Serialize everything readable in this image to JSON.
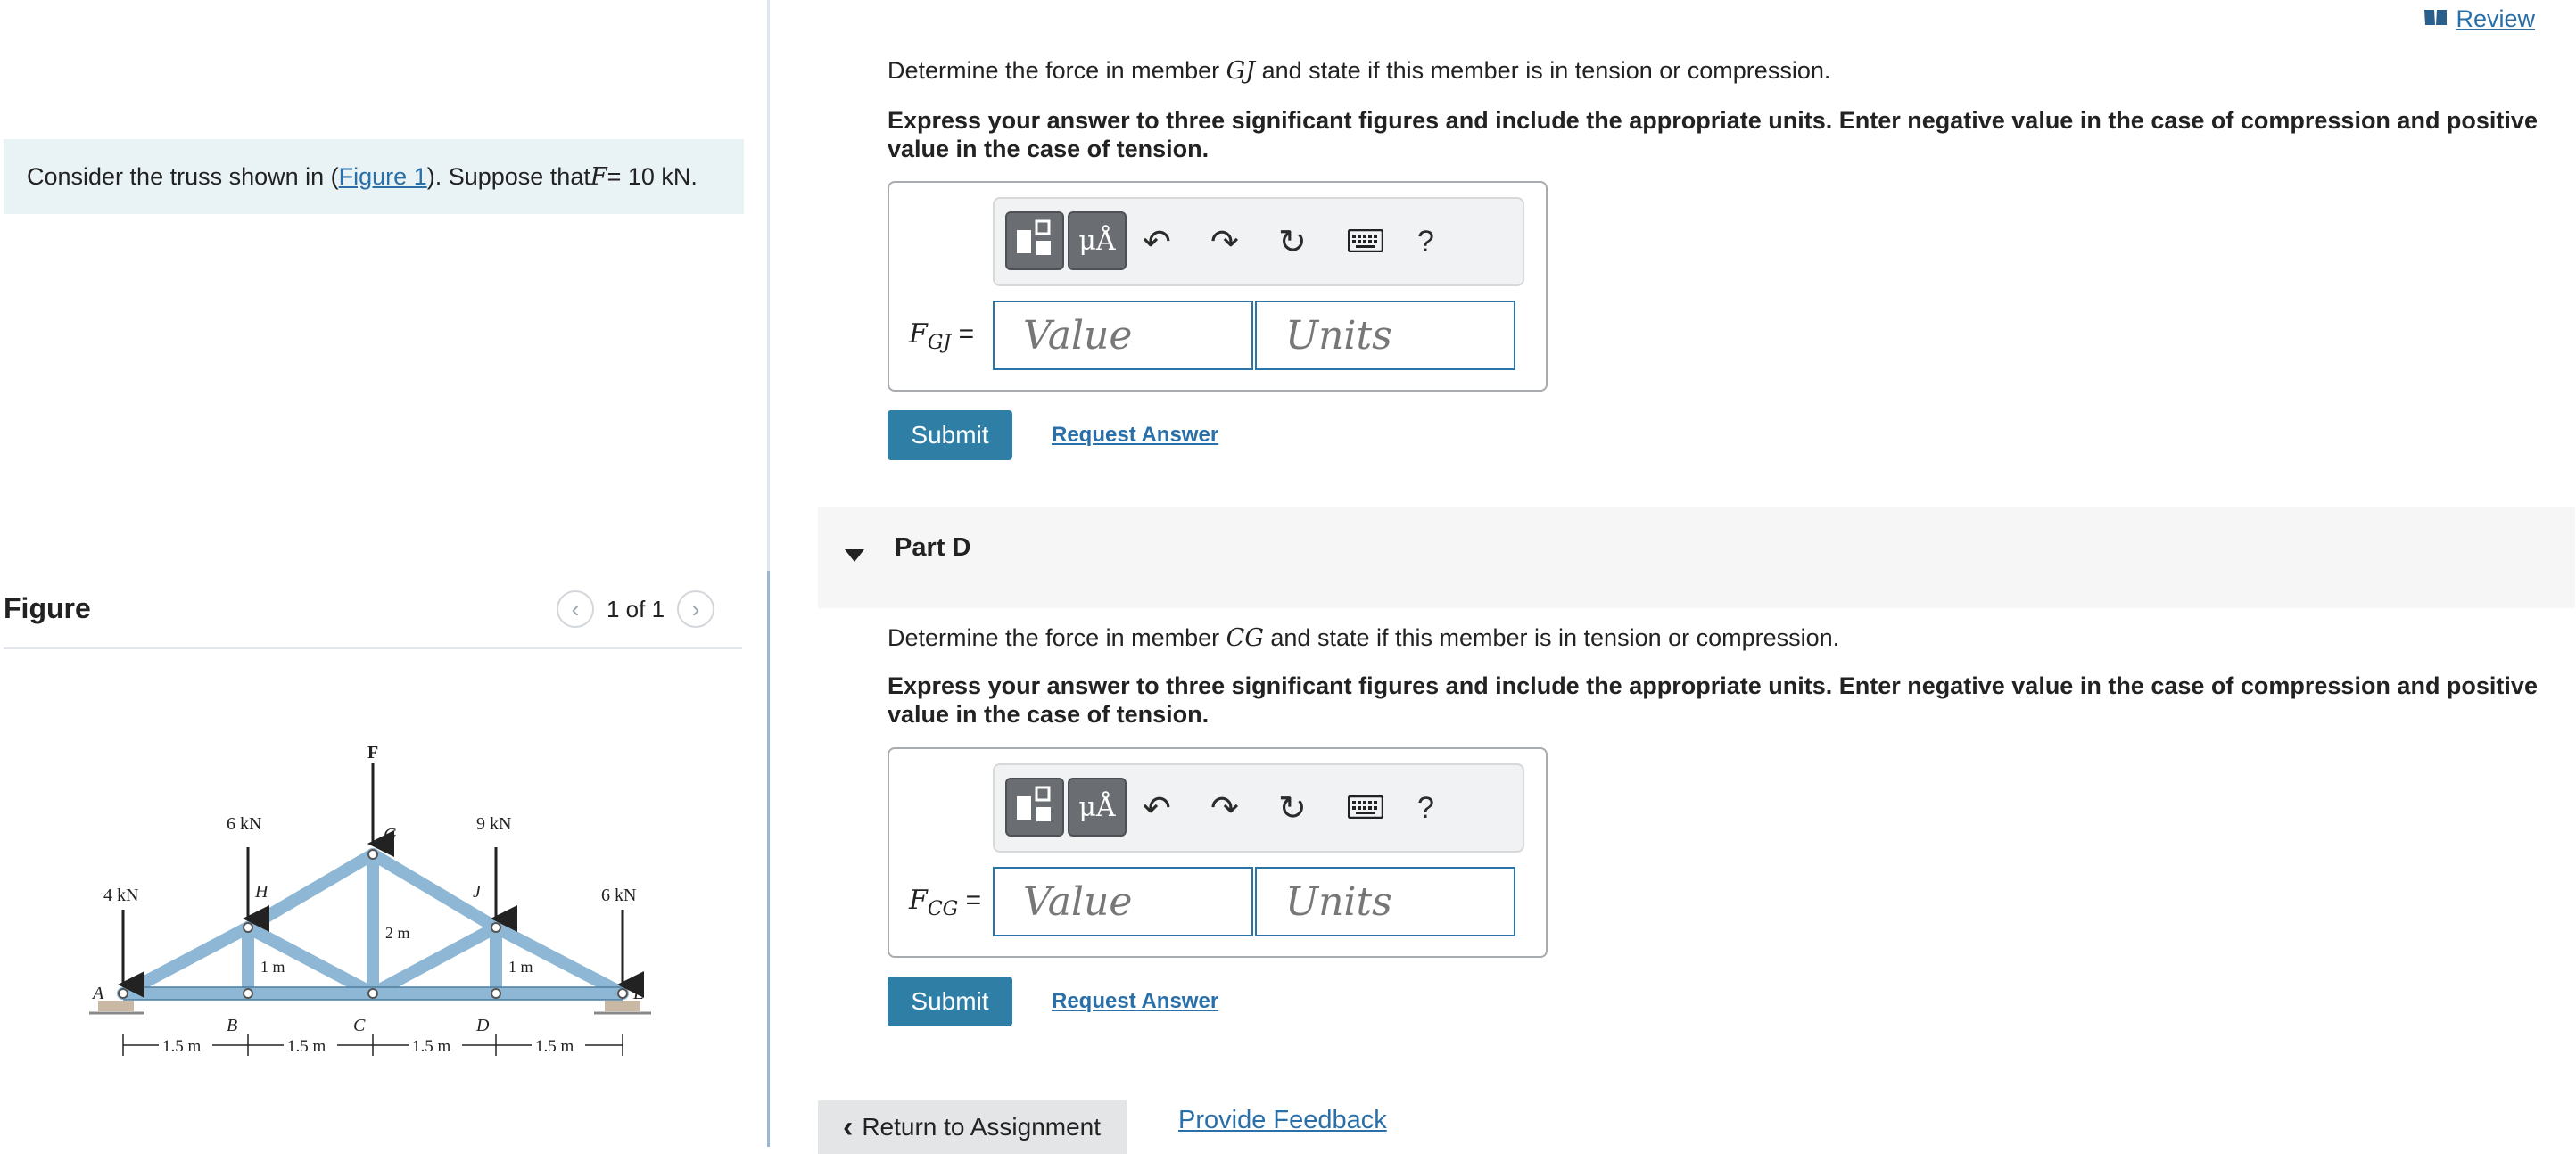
{
  "intro": {
    "prefix": "Consider the truss shown in (",
    "link": "Figure 1",
    "suffix": "). Suppose that ",
    "var": "F",
    "value": " = 10 kN."
  },
  "figure": {
    "title": "Figure",
    "pager": "1 of 1",
    "labels": {
      "load_a": "4 kN",
      "load_h": "6 kN",
      "load_g": "F",
      "load_j": "9 kN",
      "load_e": "6 kN",
      "A": "A",
      "B": "B",
      "C": "C",
      "D": "D",
      "E": "E",
      "G": "G",
      "H": "H",
      "J": "J",
      "dim_left": "1 m",
      "dim_mid": "2 m",
      "dim_right": "1 m",
      "span1": "1.5 m",
      "span2": "1.5 m",
      "span3": "1.5 m",
      "span4": "1.5 m"
    }
  },
  "header": {
    "review": "Review"
  },
  "partC": {
    "question_prefix": "Determine the force in member ",
    "member": "GJ",
    "question_suffix": " and state if this member is in tension or compression.",
    "instructions": "Express your answer to three significant figures and include the appropriate units. Enter negative value in the case of compression and positive value in the case of tension.",
    "label_var": "F",
    "label_sub": "GJ",
    "label_eq": " =",
    "value_placeholder": "Value",
    "units_placeholder": "Units",
    "submit": "Submit",
    "request": "Request Answer"
  },
  "partD": {
    "title": "Part D",
    "question_prefix": "Determine the force in member ",
    "member": "CG",
    "question_suffix": " and state if this member is in tension or compression.",
    "instructions": "Express your answer to three significant figures and include the appropriate units. Enter negative value in the case of compression and positive value in the case of tension.",
    "label_var": "F",
    "label_sub": "CG",
    "label_eq": " =",
    "value_placeholder": "Value",
    "units_placeholder": "Units",
    "submit": "Submit",
    "request": "Request Answer"
  },
  "toolbar": {
    "mu": "μÅ",
    "help": "?"
  },
  "footer": {
    "return": "Return to Assignment",
    "feedback": "Provide Feedback"
  }
}
